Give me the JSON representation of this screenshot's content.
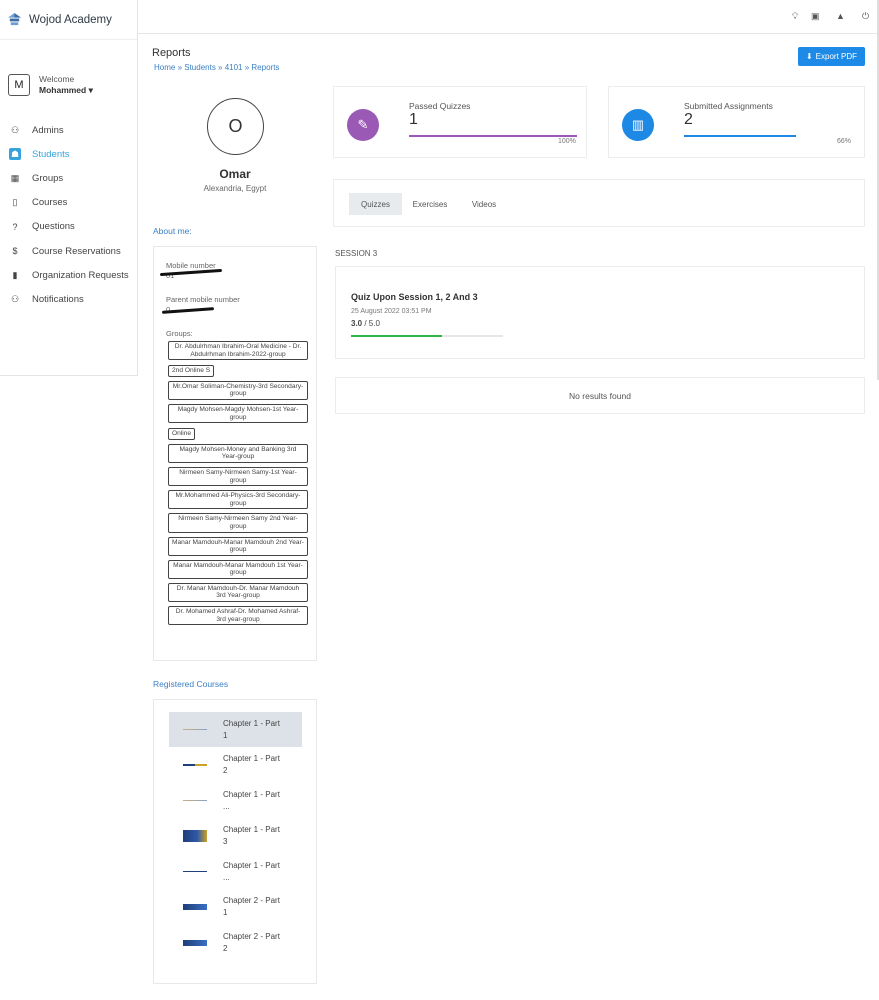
{
  "app": {
    "brand": "Wojod Academy"
  },
  "user": {
    "avatar_letter": "M",
    "welcome": "Welcome",
    "name": "Mohammed"
  },
  "sidebar": {
    "items": [
      {
        "label": "Admins",
        "icon": "users-icon",
        "glyph": "⚇",
        "active": false
      },
      {
        "label": "Students",
        "icon": "students-icon",
        "glyph": "☗",
        "active": true
      },
      {
        "label": "Groups",
        "icon": "groups-icon",
        "glyph": "▦",
        "active": false
      },
      {
        "label": "Courses",
        "icon": "courses-icon",
        "glyph": "▯",
        "active": false
      },
      {
        "label": "Questions",
        "icon": "question-icon",
        "glyph": "?",
        "active": false
      },
      {
        "label": "Course Reservations",
        "icon": "dollar-icon",
        "glyph": "$",
        "active": false
      },
      {
        "label": "Organization Requests",
        "icon": "bookmark-icon",
        "glyph": "▮",
        "active": false
      },
      {
        "label": "Notifications",
        "icon": "notifications-icon",
        "glyph": "⚇",
        "active": false
      }
    ]
  },
  "header": {
    "title": "Reports",
    "breadcrumb": "Home » Students » 4101 » Reports",
    "export_label": "Export PDF"
  },
  "profile": {
    "initial": "O",
    "name": "Omar",
    "location": "Alexandria, Egypt"
  },
  "about": {
    "section_label": "About me:",
    "mobile_label": "Mobile number",
    "mobile_value": "01",
    "parent_label": "Parent mobile number",
    "parent_value": "0",
    "groups_label": "Groups:",
    "groups": [
      {
        "text": "Dr. Abdulrhman Ibrahim-Oral Medicine - Dr. Abdulrhman Ibrahim-2022-group",
        "small": false
      },
      {
        "text": "2nd Online S",
        "small": true
      },
      {
        "text": "Mr.Omar Soliman-Chemistry-3rd Secondary-group",
        "small": false
      },
      {
        "text": "Magdy Mohsen-Magdy Mohsen-1st Year-group",
        "small": false
      },
      {
        "text": "Online",
        "small": true
      },
      {
        "text": "Magdy Mohsen-Money and Banking 3rd Year-group",
        "small": false
      },
      {
        "text": "Nirmeen Samy-Nirmeen Samy-1st Year-group",
        "small": false
      },
      {
        "text": "Mr.Mohammed Ali-Physics-3rd Secondary-group",
        "small": false
      },
      {
        "text": "Nirmeen Samy-Nirmeen Samy 2nd Year-group",
        "small": false
      },
      {
        "text": "Manar Mamdouh-Manar Mamdouh 2nd Year-group",
        "small": false
      },
      {
        "text": "Manar Mamdouh-Manar Mamdouh 1st Year-group",
        "small": false
      },
      {
        "text": "Dr. Manar Mamdouh-Dr. Manar Mamdouh 3rd Year-group",
        "small": false
      },
      {
        "text": "Dr. Mohamed Ashraf-Dr. Mohamed Ashraf-3rd year-group",
        "small": false
      }
    ]
  },
  "courses": {
    "section_label": "Registered Courses",
    "items": [
      {
        "title": "Chapter 1 - Part 1",
        "thumb": "line",
        "active": true
      },
      {
        "title": "Chapter 1 - Part 2",
        "thumb": "line-blue",
        "active": false
      },
      {
        "title": "Chapter 1 - Part ...",
        "thumb": "line",
        "active": false
      },
      {
        "title": "Chapter 1 - Part 3",
        "thumb": "image",
        "active": false
      },
      {
        "title": "Chapter 1 - Part ...",
        "thumb": "line-dark",
        "active": false
      },
      {
        "title": "Chapter 2 - Part 1",
        "thumb": "image-small",
        "active": false
      },
      {
        "title": "Chapter 2 - Part 2",
        "thumb": "image-small",
        "active": false
      }
    ]
  },
  "stats": {
    "passed": {
      "label": "Passed Quizzes",
      "value": "1",
      "percent": "100%",
      "fraction": 1.0,
      "color": "#9b59b6"
    },
    "submitted": {
      "label": "Submitted Assignments",
      "value": "2",
      "percent": "66%",
      "fraction": 0.66,
      "color": "#1e88e5"
    }
  },
  "tabs": [
    {
      "label": "Quizzes",
      "active": true
    },
    {
      "label": "Exercises",
      "active": false
    },
    {
      "label": "Videos",
      "active": false
    }
  ],
  "session": {
    "label": "SESSION 3",
    "quiz_title": "Quiz Upon Session 1, 2 And 3",
    "quiz_date": "25 August 2022 03:51 PM",
    "score": "3.0",
    "total": "5.0",
    "score_fraction": 0.6
  },
  "empty_state": "No results found"
}
